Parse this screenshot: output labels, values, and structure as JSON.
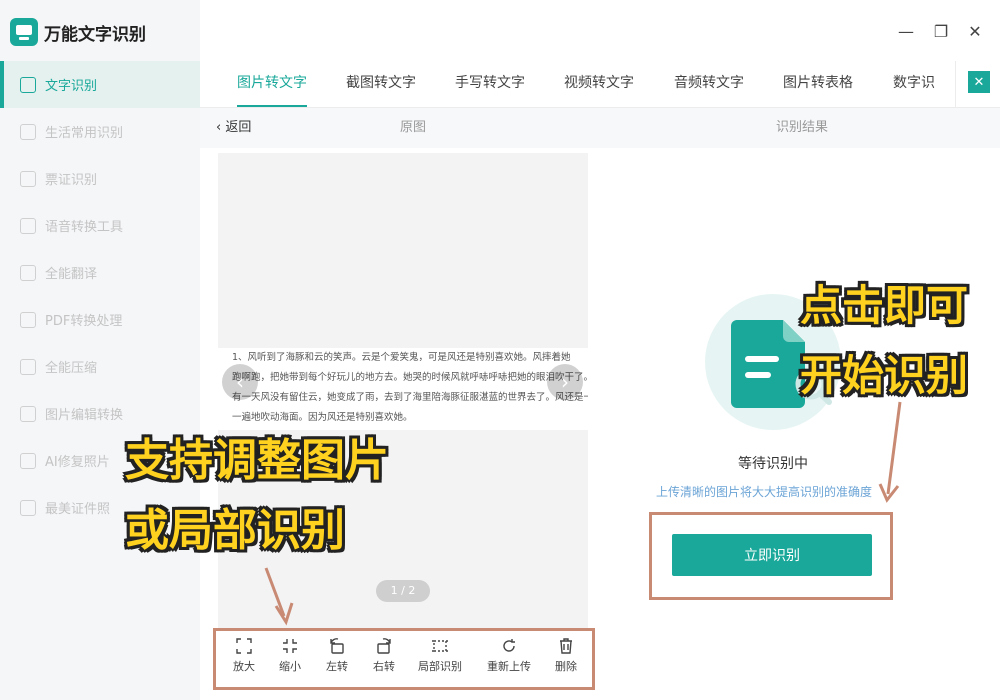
{
  "app": {
    "title": "万能文字识别"
  },
  "window": {
    "minimize": "—",
    "maximize": "❐",
    "close": "✕"
  },
  "sidebar": {
    "items": [
      {
        "label": "文字识别",
        "active": true
      },
      {
        "label": "生活常用识别"
      },
      {
        "label": "票证识别"
      },
      {
        "label": "语音转换工具"
      },
      {
        "label": "全能翻译"
      },
      {
        "label": "PDF转换处理"
      },
      {
        "label": "全能压缩"
      },
      {
        "label": "图片编辑转换"
      },
      {
        "label": "AI修复照片"
      },
      {
        "label": "最美证件照"
      }
    ]
  },
  "tabs": [
    {
      "label": "图片转文字",
      "active": true
    },
    {
      "label": "截图转文字"
    },
    {
      "label": "手写转文字"
    },
    {
      "label": "视频转文字"
    },
    {
      "label": "音频转文字"
    },
    {
      "label": "图片转表格"
    },
    {
      "label": "数字识"
    }
  ],
  "subheader": {
    "back": "返回",
    "original": "原图",
    "result": "识别结果"
  },
  "preview": {
    "text_lines": [
      "1、风听到了海豚和云的笑声。云是个爱笑鬼，可是风还是特别喜欢她。风摔着她",
      "跑啊跑，把她带到每个好玩儿的地方去。她哭的时候风就呼哧呼哧把她的眼泪吹干了。",
      "有一天风没有留住云，她变成了雨，去到了海里陪海豚征服湛蓝的世界去了。风还是一遍",
      "一遍地吹动海面。因为风还是特别喜欢她。"
    ],
    "pager": "1 / 2"
  },
  "toolbar": {
    "zoom_in": "放大",
    "zoom_out": "缩小",
    "rotate_left": "左转",
    "rotate_right": "右转",
    "partial": "局部识别",
    "reupload": "重新上传",
    "delete": "删除"
  },
  "result": {
    "status": "等待识别中",
    "hint": "上传清晰的图片将大大提高识别的准确度",
    "start_button": "立即识别"
  },
  "annotations": {
    "left_line1": "支持调整图片",
    "left_line2": "或局部识别",
    "right_line1": "点击即可",
    "right_line2": "开始识别"
  },
  "colors": {
    "accent": "#1aa89a",
    "highlight_border": "#c98a74",
    "annotation_fill": "#ffd21f"
  }
}
